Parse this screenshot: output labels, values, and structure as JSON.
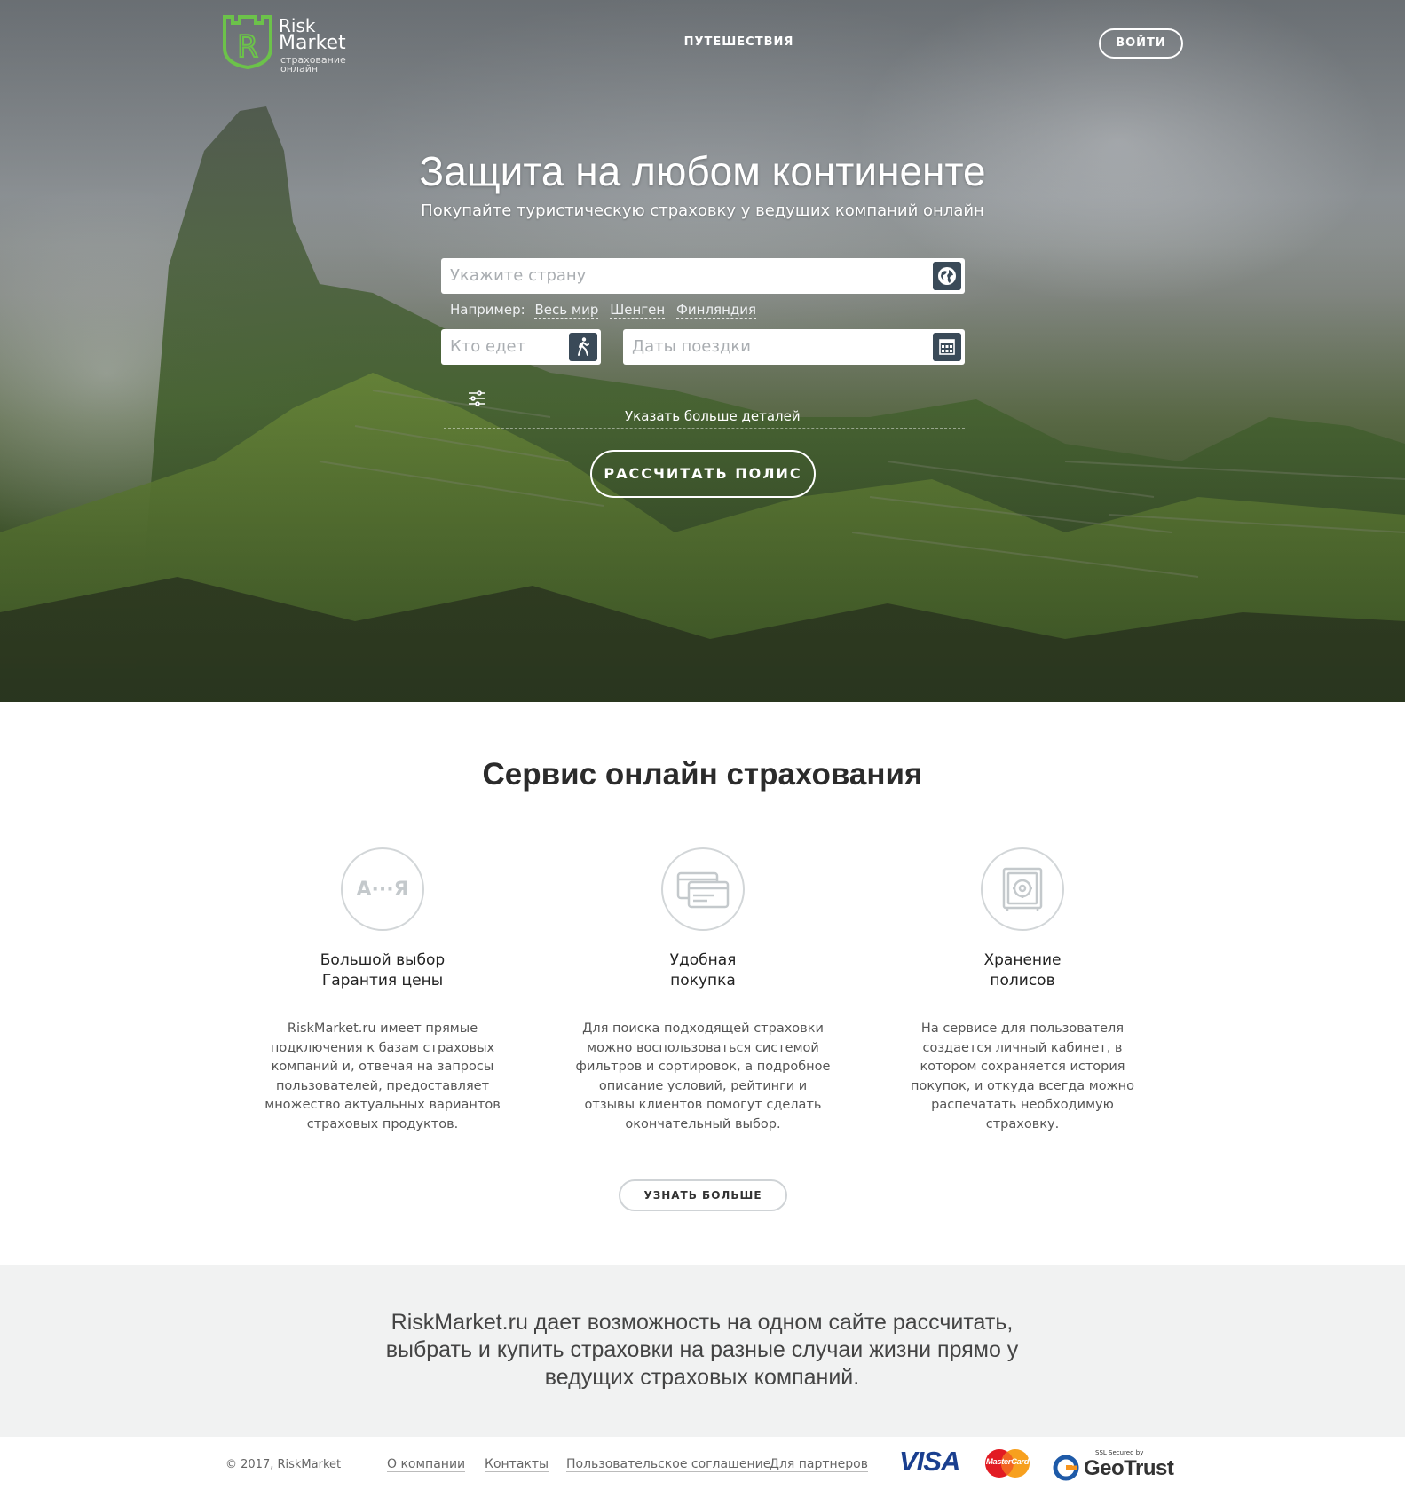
{
  "header": {
    "logo": {
      "line1": "Risk",
      "line2": "Market",
      "line3": "страхование",
      "line4": "онлайн"
    },
    "nav_travel": "ПУТЕШЕСТВИЯ",
    "login_label": "ВОЙТИ"
  },
  "hero": {
    "title": "Защита на любом континенте",
    "subtitle": "Покупайте туристическую страховку у ведущих компаний онлайн",
    "country_placeholder": "Укажите страну",
    "examples_label": "Например:",
    "examples": [
      "Весь мир",
      "Шенген",
      "Финляндия"
    ],
    "who_placeholder": "Кто едет",
    "dates_placeholder": "Даты поездки",
    "more_details": "Указать больше деталей",
    "calc_button": "РАССЧИТАТЬ ПОЛИС"
  },
  "services": {
    "title": "Сервис онлайн страхования",
    "items": [
      {
        "icon": "a-to-ya-icon",
        "icon_text": "А···Я",
        "title1": "Большой выбор",
        "title2": "Гарантия цены",
        "text": "RiskMarket.ru имеет прямые подключения к базам страховых компаний и, отвечая на запросы пользователей, предоставляет множество актуальных вариантов страховых продуктов."
      },
      {
        "icon": "credit-cards-icon",
        "title1": "Удобная",
        "title2": "покупка",
        "text": "Для поиска подходящей страховки можно воспользоваться системой фильтров и сортировок, а подробное описание условий, рейтинги и отзывы клиентов помогут сделать окончательный выбор."
      },
      {
        "icon": "safe-icon",
        "title1": "Хранение",
        "title2": "полисов",
        "text": "На сервисе для пользователя создается личный кабинет, в котором сохраняется история покупок, и откуда всегда можно распечатать необходимую страховку."
      }
    ],
    "more_button": "УЗНАТЬ БОЛЬШЕ"
  },
  "about": {
    "text": "RiskMarket.ru дает возможность на одном сайте рассчитать, выбрать и купить страховки на разные случаи жизни прямо у ведущих страховых компаний."
  },
  "footer": {
    "copyright": "© 2017, RiskMarket",
    "links": [
      "О компании",
      "Контакты",
      "Пользовательское соглашение",
      "Для партнеров"
    ],
    "visa": "VISA",
    "mastercard": "MasterCard",
    "geotrust_small": "SSL Secured by",
    "geotrust": "GeoTrust"
  },
  "colors": {
    "brand_green": "#6cc24a",
    "icon_button": "#3a4a58",
    "about_bg": "#f1f2f2"
  }
}
